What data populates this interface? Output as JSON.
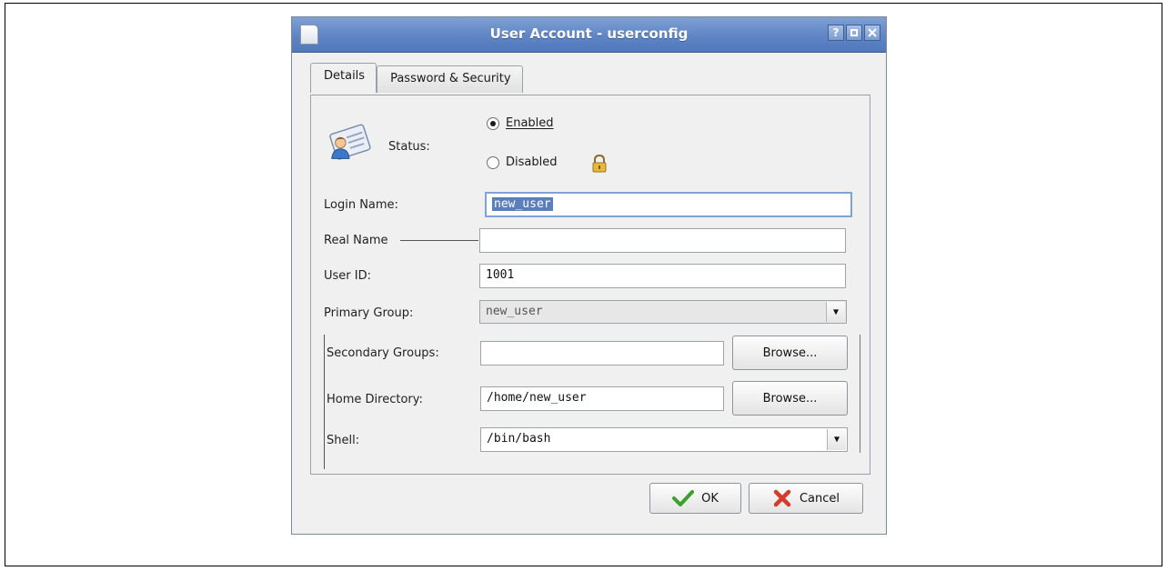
{
  "window": {
    "title": "User Account - userconfig",
    "help_button": "?"
  },
  "tabs": [
    {
      "label": "Details",
      "mnemonic_index": 2
    },
    {
      "label": "Password & Security",
      "mnemonic_index": 0
    }
  ],
  "status": {
    "label": "Status:",
    "enabled_label": "Enabled",
    "disabled_label": "Disabled",
    "selected": "Enabled"
  },
  "form": {
    "login_name_label": "Login Name:",
    "login_name_value": "new_user",
    "real_name_label": "Real Name",
    "real_name_value": "",
    "user_id_label": "User ID:",
    "user_id_value": "1001",
    "primary_group_label": "Primary Group:",
    "primary_group_value": "new_user",
    "secondary_groups_label": "Secondary Groups:",
    "secondary_groups_value": "",
    "home_directory_label": "Home Directory:",
    "home_directory_value": "/home/new_user",
    "shell_label": "Shell:",
    "shell_value": "/bin/bash"
  },
  "buttons": {
    "browse_label": "Browse...",
    "ok_label": "OK",
    "cancel_label": "Cancel"
  },
  "colors": {
    "titlebar": "#5f85c4",
    "window_bg": "#eff0ef",
    "selection": "#5b7fb8",
    "ok_check": "#3aa12c",
    "cancel_x": "#d83a2a"
  },
  "icons": {
    "title": "document-icon",
    "user": "user-card-icon",
    "lock": "lock-icon",
    "ok": "checkmark-icon",
    "cancel": "cross-icon"
  }
}
